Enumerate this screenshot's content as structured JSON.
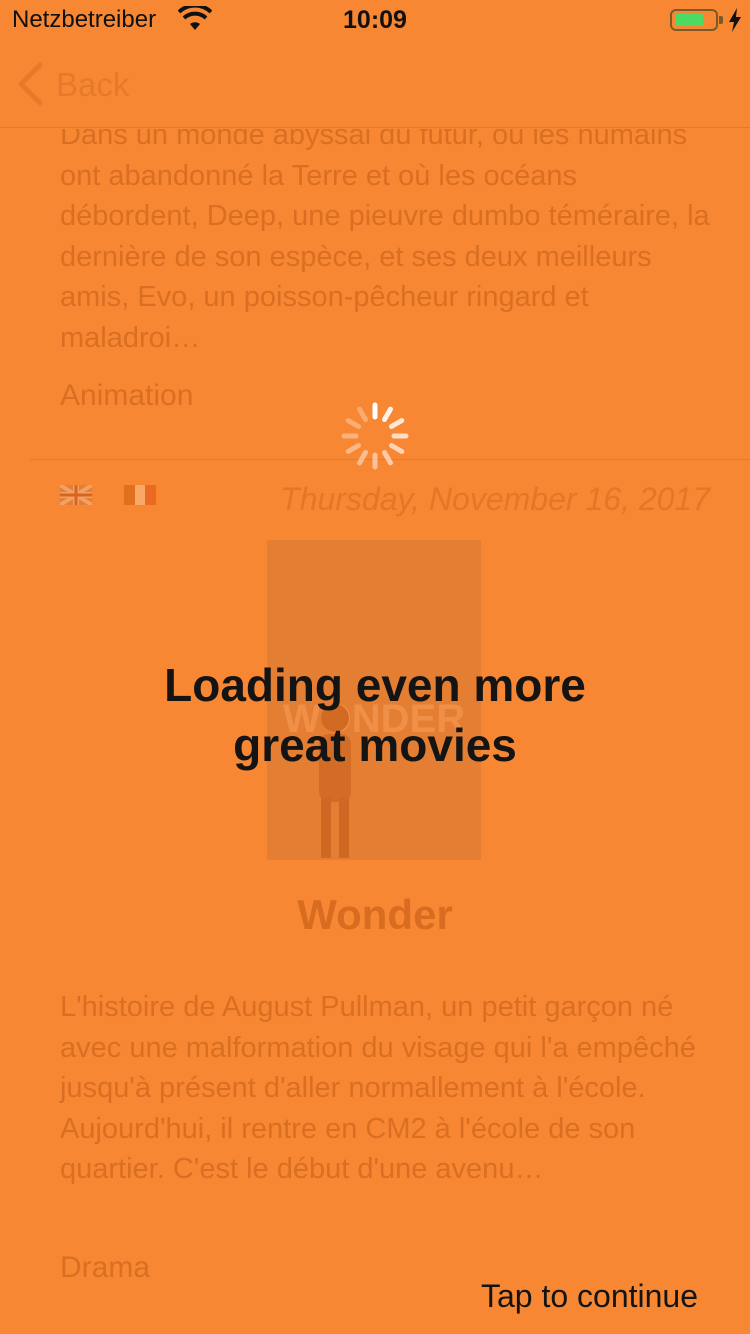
{
  "status_bar": {
    "carrier": "Netzbetreiber",
    "time": "10:09",
    "battery_color": "#4cd964"
  },
  "nav": {
    "back_label": "Back",
    "back_icon": "chevron-left-icon"
  },
  "movies": [
    {
      "synopsis": "Dans un monde abyssal du futur, où les humains ont abandonné la Terre et où les océans débordent, Deep, une pieuvre dumbo téméraire, la dernière de son espèce, et ses deux meilleurs amis, Evo, un poisson-pêcheur ringard et maladroi…",
      "genre": "Animation"
    },
    {
      "languages": [
        "uk-flag-icon",
        "france-flag-icon"
      ],
      "date": "Thursday, November 16, 2017",
      "poster_text": "WONDER",
      "title": "Wonder",
      "synopsis": "L'histoire de August Pullman, un petit garçon né avec une malformation du visage qui l'a empêché jusqu'à présent d'aller normallement à l'école. Aujourd'hui, il rentre en CM2 à l'école de son quartier. C'est le début d'une avenu…",
      "genre": "Drama"
    }
  ],
  "overlay": {
    "background_color": "#f88734",
    "message": "Loading even more great movies",
    "tap_hint": "Tap to continue",
    "spinner_icon": "activity-spinner-icon"
  }
}
